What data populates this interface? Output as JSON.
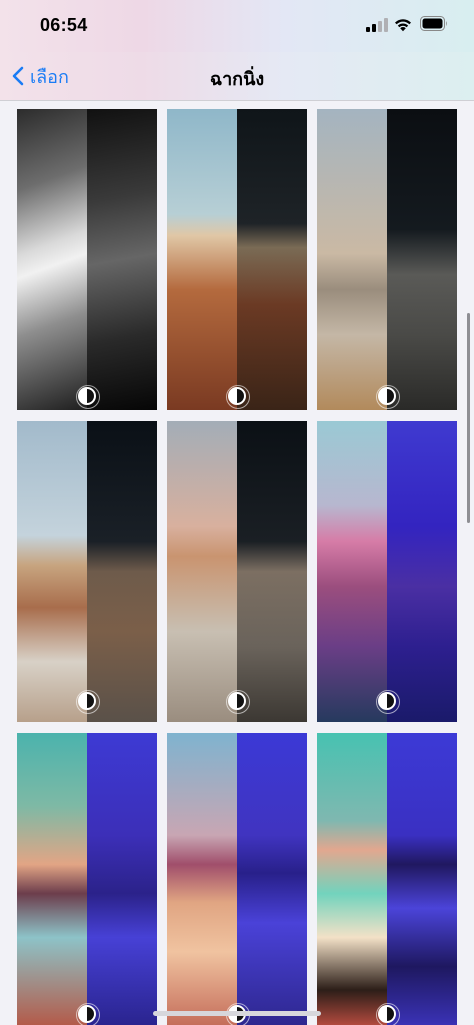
{
  "status_bar": {
    "time": "06:54",
    "signal_bars_lit": 2,
    "signal_bars_total": 4
  },
  "nav": {
    "back_label": "เลือก",
    "title": "ฉากนิ่ง"
  },
  "wallpapers": [
    {
      "name": "wallpaper-ios-abstract",
      "left": "linear-gradient(160deg,#2c2c2c 0%,#6d6d6d 25%,#d9d9d9 45%,#f1f1f1 52%,#8e8e8e 70%,#1e1e1e 100%)",
      "right": "linear-gradient(170deg,#111 0%,#3a3a3a 30%,#666 50%,#2a2a2a 75%,#060606 100%)"
    },
    {
      "name": "wallpaper-red-rock-1",
      "left": "linear-gradient(180deg,#8fb7c9 0%,#b7cfd5 35%,#e0c7a6 42%,#b46a3e 60%,#7a3a22 100%)",
      "right": "linear-gradient(180deg,#0f1519 0%,#1e2327 38%,#7a6b55 46%,#6b3a24 65%,#3a2417 100%)"
    },
    {
      "name": "wallpaper-grey-dune",
      "left": "linear-gradient(180deg,#a4b4c0 0%,#cab9a4 48%,#9a8d7d 60%,#c4b7a6 75%,#b28a5c 100%)",
      "right": "linear-gradient(180deg,#0b0e12 0%,#141a1f 40%,#5a5a57 55%,#4a4a47 75%,#2a2a28 100%)"
    },
    {
      "name": "wallpaper-red-rock-2",
      "left": "linear-gradient(180deg,#a2bacb 0%,#c4d3dc 38%,#c7a47f 48%,#a86d4c 62%,#d8d1c7 80%,#b7a08b 100%)",
      "right": "linear-gradient(180deg,#0a1016 0%,#1a2027 40%,#6e5b4b 50%,#7b5f49 70%,#5a5149 100%)"
    },
    {
      "name": "wallpaper-red-rock-3",
      "left": "linear-gradient(180deg,#a3adb7 0%,#d8b09e 35%,#c99470 45%,#c8bfb2 70%,#9a8d7f 100%)",
      "right": "linear-gradient(180deg,#0b1015 0%,#1a1f24 40%,#7c6f62 50%,#6a635b 75%,#3c3833 100%)"
    },
    {
      "name": "wallpaper-coast-road",
      "left": "linear-gradient(180deg,#9ac9d4 0%,#b7b7cf 28%,#d67ca7 40%,#9b4e7e 55%,#6a3e86 75%,#263a5e 100%)",
      "right": "linear-gradient(180deg,#3f3ad0 0%,#3324c0 35%,#4a2fa3 55%,#2d1f8f 75%,#1a1a6a 100%)"
    },
    {
      "name": "wallpaper-lake-sunset",
      "left": "linear-gradient(180deg,#4bb3ad 0%,#7eb9a5 25%,#e2a585 45%,#6c3d4c 55%,#8dc3c8 70%,#b35b4a 100%)",
      "right": "linear-gradient(180deg,#3d3ad4 0%,#3c2fb8 35%,#2b228a 55%,#4741d6 70%,#2a248f 100%)"
    },
    {
      "name": "wallpaper-desert-dunes",
      "left": "linear-gradient(180deg,#7fb3cf 0%,#c8a6b3 35%,#a04e6b 45%,#e0a582 58%,#f0c3a0 75%,#c56e5b 100%)",
      "right": "linear-gradient(180deg,#3b39d6 0%,#4034c0 35%,#28208a 48%,#4a42d8 65%,#2e278f 100%)"
    },
    {
      "name": "wallpaper-island-trees",
      "left": "linear-gradient(180deg,#47c2b1 0%,#7fb8b0 30%,#e2a78f 40%,#72d3bd 55%,#f3e1c7 70%,#2c1e18 88%,#b24a3e 100%)",
      "right": "linear-gradient(180deg,#3c3ad6 0%,#3a30c2 35%,#201860 45%,#4b44d9 60%,#1e1860 80%,#3a32b5 100%)"
    }
  ]
}
